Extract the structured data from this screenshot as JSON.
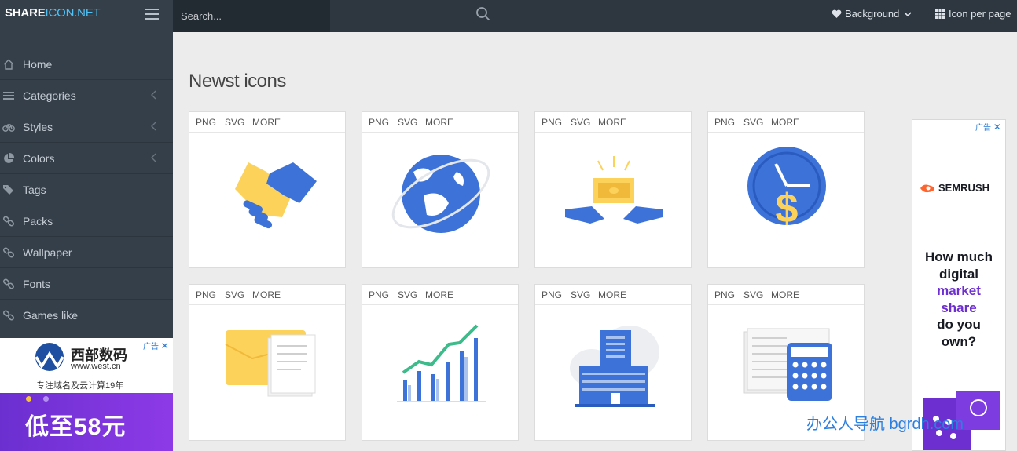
{
  "header": {
    "logo_part1": "SHARE",
    "logo_part2": "ICON.NET",
    "search_placeholder": "Search...",
    "background_label": "Background",
    "icon_per_page_label": "Icon per page"
  },
  "sidebar": {
    "items": [
      {
        "label": "Home",
        "icon": "home-icon"
      },
      {
        "label": "Categories",
        "icon": "list-icon",
        "has_chevron": true
      },
      {
        "label": "Styles",
        "icon": "bicycle-icon",
        "has_chevron": true
      },
      {
        "label": "Colors",
        "icon": "pie-chart-icon",
        "has_chevron": true
      },
      {
        "label": "Tags",
        "icon": "tags-icon"
      },
      {
        "label": "Packs",
        "icon": "link-icon"
      },
      {
        "label": "Wallpaper",
        "icon": "link-icon"
      },
      {
        "label": "Fonts",
        "icon": "link-icon"
      },
      {
        "label": "Games like",
        "icon": "link-icon"
      }
    ]
  },
  "side_ad": {
    "ad_mark": "广告",
    "brand": "西部数码",
    "url": "www.west.cn",
    "tagline": "专注域名及云计算19年",
    "promo": "低至58元"
  },
  "main": {
    "title": "Newst icons",
    "format_labels": {
      "png": "PNG",
      "svg": "SVG",
      "more": "MORE"
    },
    "icons": [
      {
        "name": "handshake-icon"
      },
      {
        "name": "globe-icon"
      },
      {
        "name": "money-hands-icon"
      },
      {
        "name": "dollar-clock-icon"
      },
      {
        "name": "folder-documents-icon"
      },
      {
        "name": "growth-chart-icon"
      },
      {
        "name": "office-building-icon"
      },
      {
        "name": "calculator-icon"
      }
    ]
  },
  "right_ad": {
    "ad_mark": "广告",
    "brand": "SEMRUSH",
    "line1": "How much",
    "line2": "digital",
    "line3": "market",
    "line4": "share",
    "line5": "do you",
    "line6": "own?"
  },
  "watermark": "办公人导航 bgrdh.com",
  "colors": {
    "topbar": "#2e3740",
    "sidebar": "#353f4a",
    "accent": "#4fc3f7",
    "icon_blue": "#3d73d9",
    "icon_yellow": "#fcd25a"
  }
}
